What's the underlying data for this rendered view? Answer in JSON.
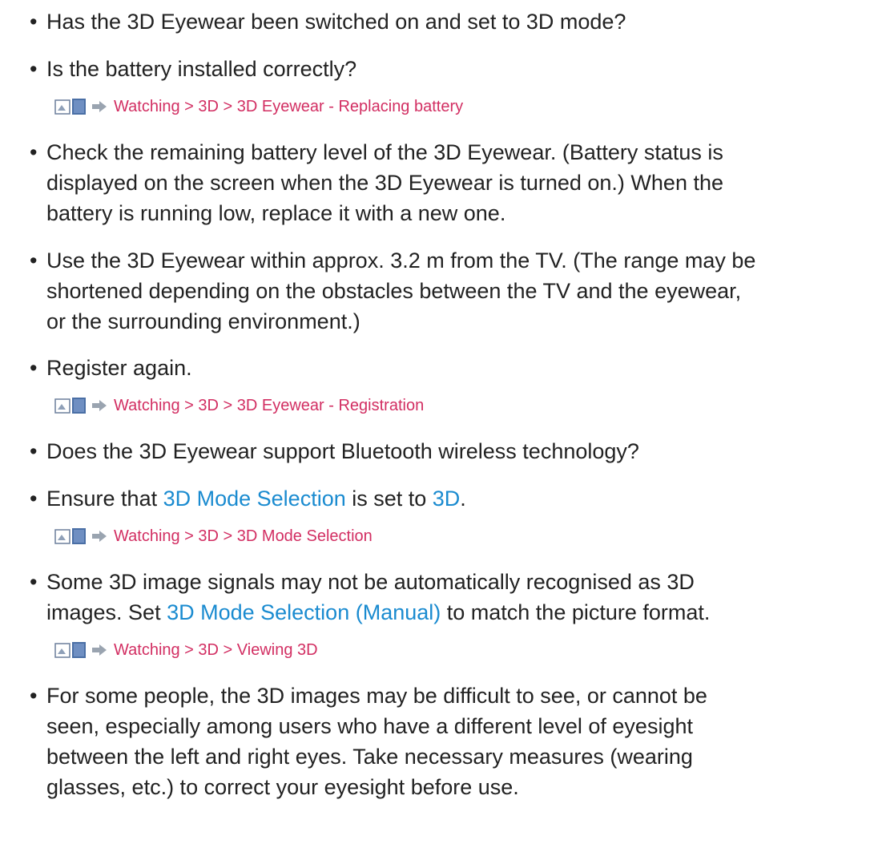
{
  "items": [
    {
      "text": "Has the 3D Eyewear been switched on and set to 3D mode?"
    },
    {
      "text": "Is the battery installed correctly?"
    },
    {
      "text": "Check the remaining battery level of the 3D Eyewear. (Battery status is\ndisplayed on the screen when the 3D Eyewear is turned on.) When the\nbattery is running low, replace it with a new one."
    },
    {
      "text": "Use the 3D Eyewear within approx. 3.2 m from the TV. (The range may be\nshortened depending on the obstacles between the TV and the eyewear,\nor the surrounding environment.)"
    },
    {
      "text": "Register again."
    },
    {
      "text": "Does the 3D Eyewear support Bluetooth wireless technology?"
    },
    {
      "pre": "Ensure that ",
      "link1": "3D Mode Selection",
      "mid": " is set to ",
      "link2": "3D",
      "post": "."
    },
    {
      "line1": "Some 3D image signals may not be automatically recognised as 3D",
      "pre": "images. Set ",
      "link1": "3D Mode Selection (Manual)",
      "post": " to match the picture format."
    },
    {
      "text": "For some people, the 3D images may be difficult to see, or cannot be\nseen, especially among users who have a different level of eyesight\nbetween the left and right eyes. Take necessary measures (wearing\nglasses, etc.) to correct your eyesight before use."
    }
  ],
  "refs": [
    {
      "text": "Watching > 3D > 3D Eyewear - Replacing battery"
    },
    {
      "text": "Watching > 3D > 3D Eyewear - Registration"
    },
    {
      "text": "Watching > 3D > 3D Mode Selection"
    },
    {
      "text": "Watching > 3D > Viewing 3D"
    }
  ],
  "bullet_char": "•",
  "icons": {
    "ref_icon": "emanual-book-icon",
    "ref_arrow": "right-arrow-icon"
  },
  "colors": {
    "text": "#222222",
    "reference_link": "#d22e62",
    "setting_link": "#1a8bd0",
    "icon_fill": "#5a6e8a"
  }
}
